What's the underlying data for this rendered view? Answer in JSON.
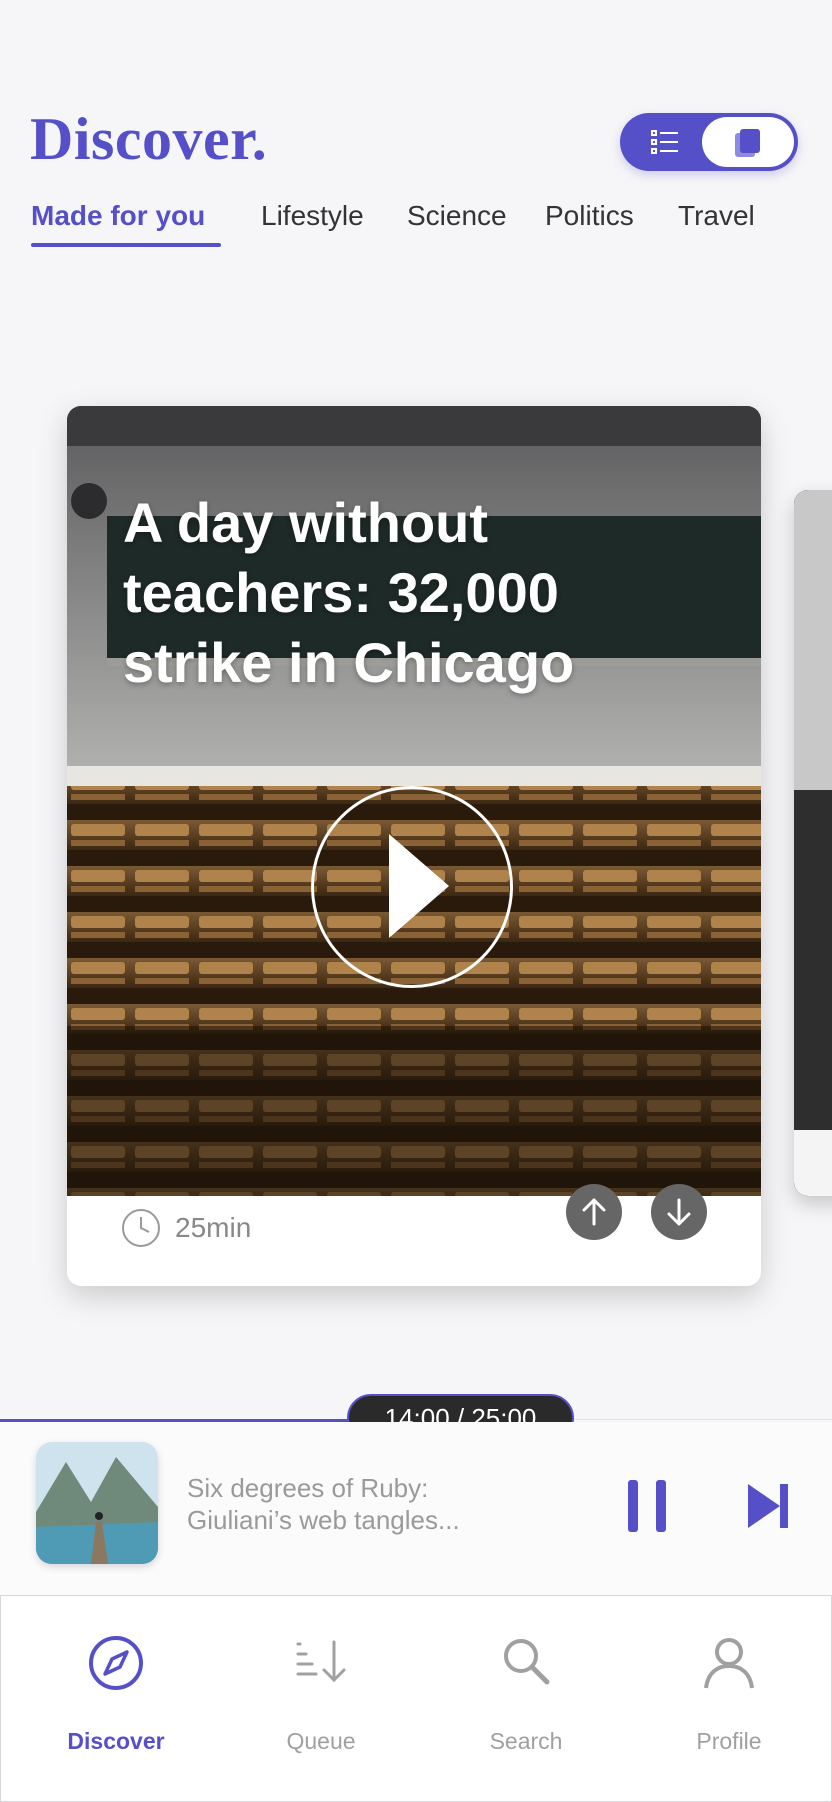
{
  "header": {
    "title": "Discover.",
    "view_toggle": {
      "left_icon": "list-icon",
      "right_icon": "cards-icon",
      "selected": "cards"
    }
  },
  "tabs": [
    {
      "label": "Made for you",
      "active": true
    },
    {
      "label": "Lifestyle",
      "active": false
    },
    {
      "label": "Science",
      "active": false
    },
    {
      "label": "Politics",
      "active": false
    },
    {
      "label": "Travel",
      "active": false
    }
  ],
  "card": {
    "title": "A day without teachers: 32,000 strike in Chicago",
    "duration": "25min",
    "icons": [
      "play-icon",
      "clock-icon",
      "arrow-up-icon",
      "arrow-down-icon"
    ]
  },
  "player": {
    "time": "14:00 / 25:00",
    "progress": 0.42,
    "title_line1": "Six degrees of Ruby:",
    "title_line2": "Giuliani’s web tangles...",
    "icons": [
      "pause-icon",
      "skip-next-icon"
    ]
  },
  "nav": [
    {
      "label": "Discover",
      "icon": "compass-icon",
      "active": true
    },
    {
      "label": "Queue",
      "icon": "queue-icon",
      "active": false
    },
    {
      "label": "Search",
      "icon": "search-icon",
      "active": false
    },
    {
      "label": "Profile",
      "icon": "profile-icon",
      "active": false
    }
  ],
  "colors": {
    "accent": "#5650c8",
    "inactive": "#a0a0a0",
    "dark_pill": "#2a2a2a"
  }
}
